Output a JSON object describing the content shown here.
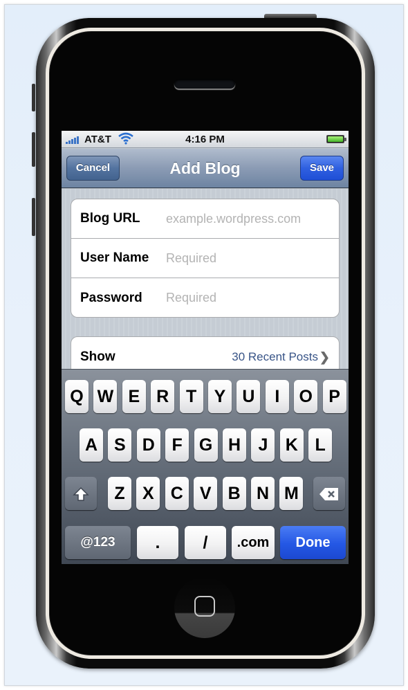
{
  "status_bar": {
    "carrier": "AT&T",
    "time": "4:16 PM",
    "signal_bars": 5,
    "wifi": "wifi-icon",
    "battery": "battery-full-icon"
  },
  "nav": {
    "title": "Add Blog",
    "cancel_label": "Cancel",
    "save_label": "Save"
  },
  "form": {
    "fields": [
      {
        "label": "Blog URL",
        "value": "",
        "placeholder": "example.wordpress.com"
      },
      {
        "label": "User Name",
        "value": "",
        "placeholder": "Required"
      },
      {
        "label": "Password",
        "value": "",
        "placeholder": "Required"
      }
    ],
    "show": {
      "label": "Show",
      "value": "30 Recent Posts",
      "chevron": "chevron-right-icon"
    }
  },
  "keyboard": {
    "row1": [
      "Q",
      "W",
      "E",
      "R",
      "T",
      "Y",
      "U",
      "I",
      "O",
      "P"
    ],
    "row2": [
      "A",
      "S",
      "D",
      "F",
      "G",
      "H",
      "J",
      "K",
      "L"
    ],
    "row3": [
      "Z",
      "X",
      "C",
      "V",
      "B",
      "N",
      "M"
    ],
    "shift": "shift-icon",
    "delete": "delete-icon",
    "numbers_label": "@123",
    "dot_label": ".",
    "slash_label": "/",
    "dotcom_label": ".com",
    "done_label": "Done"
  }
}
